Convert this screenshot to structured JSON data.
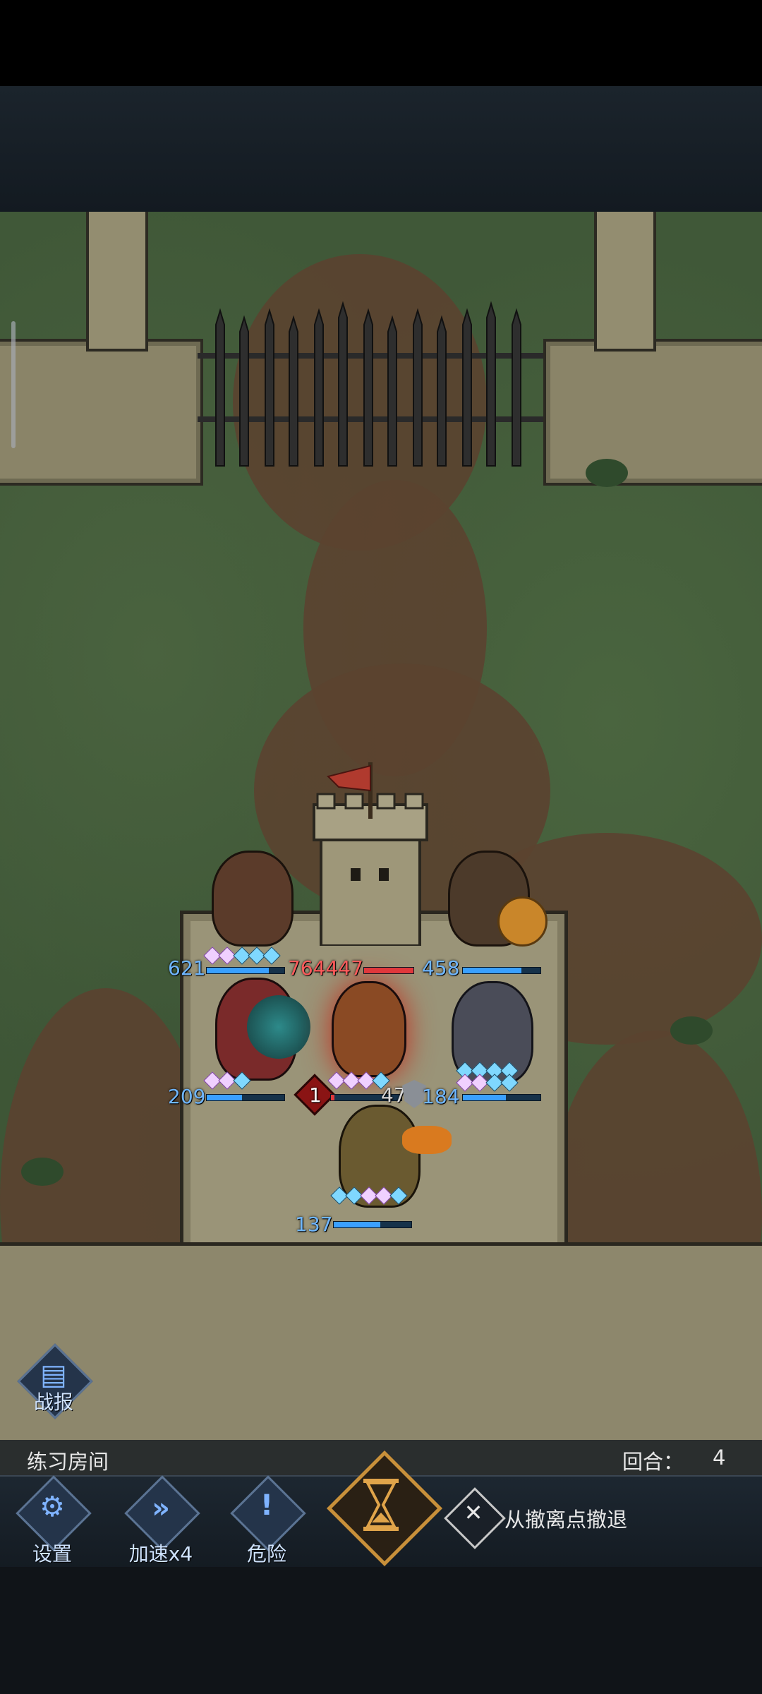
{
  "hud": {
    "room_label": "练习房间",
    "round_label": "回合：",
    "round_value": "4"
  },
  "buttons": {
    "battle_report": "战报",
    "settings": "设置",
    "speed": "加速x4",
    "danger": "危险",
    "retreat": "从撤离点撤退"
  },
  "units": {
    "ally_top_left_hp": "621",
    "tower_hp": "764447",
    "ally_top_right_hp": "458",
    "ally_mid_left_hp": "209",
    "boss_hp": "1",
    "boss_shield": "479",
    "ally_mid_right_hp": "184",
    "ally_front_hp": "137"
  },
  "colors": {
    "ally_hp": "#6fb6ff",
    "enemy_hp": "#ff5b5b",
    "grass": "#405838",
    "stone": "#9a9478"
  },
  "icons": {
    "battle_report": "document-icon",
    "settings": "gear-icon",
    "speed": "fast-forward-icon",
    "danger": "exclamation-icon",
    "end_turn": "hourglass-icon",
    "retreat": "crossed-swords-icon"
  }
}
